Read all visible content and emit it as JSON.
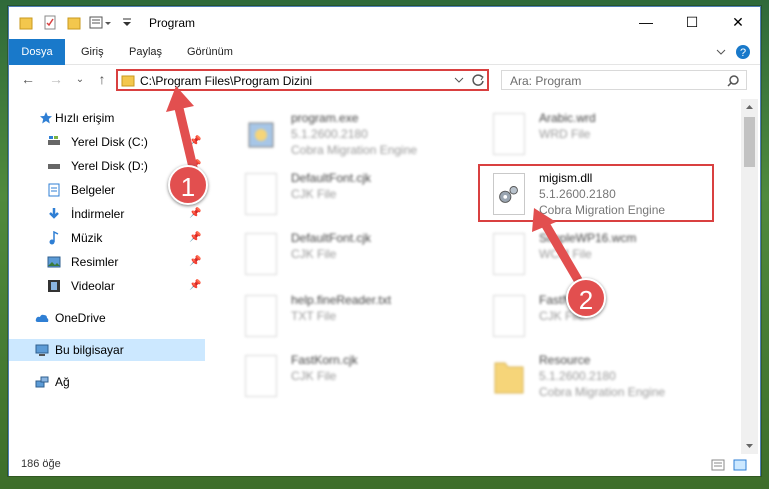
{
  "titlebar": {
    "title": "Program",
    "minimize_label": "—",
    "maximize_label": "☐",
    "close_label": "✕"
  },
  "ribbon": {
    "tabs": [
      "Dosya",
      "Giriş",
      "Paylaş",
      "Görünüm"
    ]
  },
  "navigation": {
    "address": "C:\\Program Files\\Program Dizini",
    "search_placeholder": "Ara: Program"
  },
  "sidebar": {
    "items": [
      {
        "label": "Hızlı erişim",
        "icon": "star-icon"
      },
      {
        "label": "Yerel Disk (C:)",
        "icon": "drive-icon"
      },
      {
        "label": "Yerel Disk (D:)",
        "icon": "drive-icon"
      },
      {
        "label": "Belgeler",
        "icon": "documents-icon"
      },
      {
        "label": "İndirmeler",
        "icon": "download-icon"
      },
      {
        "label": "Müzik",
        "icon": "music-icon"
      },
      {
        "label": "Resimler",
        "icon": "pictures-icon"
      },
      {
        "label": "Videolar",
        "icon": "videos-icon"
      },
      {
        "label": "OneDrive",
        "icon": "cloud-icon"
      },
      {
        "label": "Bu bilgisayar",
        "icon": "computer-icon"
      },
      {
        "label": "Ağ",
        "icon": "network-icon"
      }
    ]
  },
  "files": [
    {
      "name": "program.exe",
      "line1": "5.1.2600.2180",
      "line2": "Cobra Migration Engine"
    },
    {
      "name": "Arabic.wrd",
      "line1": "WRD File",
      "line2": ""
    },
    {
      "name": "DefaultFont.cjk",
      "line1": "CJK File",
      "line2": ""
    },
    {
      "name": "migism.dll",
      "line1": "5.1.2600.2180",
      "line2": "Cobra Migration Engine"
    },
    {
      "name": "DefaultFont.cjk",
      "line1": "CJK File",
      "line2": ""
    },
    {
      "name": "SimpleWP16.wcm",
      "line1": "WCM File",
      "line2": ""
    },
    {
      "name": "help.fineReader.txt",
      "line1": "TXT File",
      "line2": ""
    },
    {
      "name": "FastN...",
      "line1": "CJK File",
      "line2": ""
    },
    {
      "name": "FastKorn.cjk",
      "line1": "CJK File",
      "line2": ""
    },
    {
      "name": "Resource",
      "line1": "5.1.2600.2180",
      "line2": "Cobra Migration Engine"
    }
  ],
  "status": {
    "count": "186 öğe"
  },
  "annotations": {
    "badge1": "1",
    "badge2": "2"
  },
  "colors": {
    "accent": "#1979ca",
    "highlight": "#d94040"
  }
}
